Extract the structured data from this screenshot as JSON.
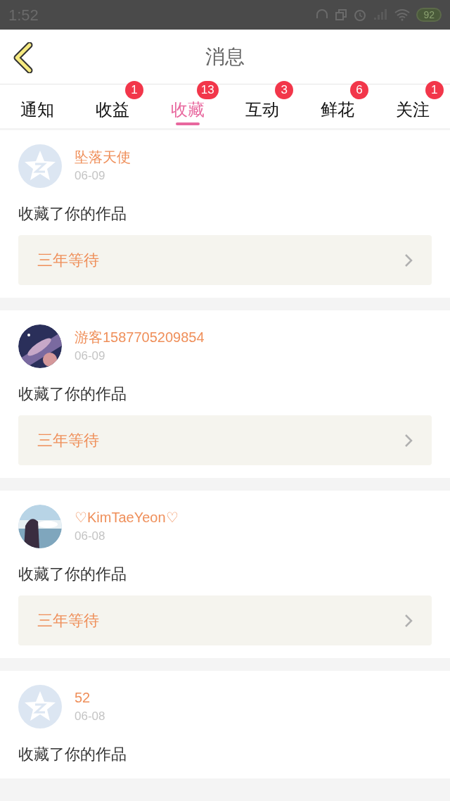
{
  "status_bar": {
    "time": "1:52",
    "battery": "92"
  },
  "header": {
    "title": "消息"
  },
  "tabs": [
    {
      "label": "通知",
      "selected": false
    },
    {
      "label": "收益",
      "selected": false,
      "badge": "1"
    },
    {
      "label": "收藏",
      "selected": true,
      "badge": "13"
    },
    {
      "label": "互动",
      "selected": false,
      "badge": "3"
    },
    {
      "label": "鲜花",
      "selected": false,
      "badge": "6"
    },
    {
      "label": "关注",
      "selected": false,
      "badge": "1"
    }
  ],
  "messages": [
    {
      "avatar": {
        "kind": "default"
      },
      "name": "坠落天使",
      "date": "06-09",
      "text": "收藏了你的作品",
      "work": "三年等待"
    },
    {
      "name": "游客1587705209854",
      "date": "06-09",
      "text": "收藏了你的作品",
      "work": "三年等待"
    },
    {
      "name": "♡KimTaeYeon♡",
      "date": "06-08",
      "text": "收藏了你的作品",
      "work": "三年等待"
    },
    {
      "avatar": {
        "kind": "default"
      },
      "name": "52",
      "date": "06-08",
      "text": "收藏了你的作品"
    }
  ]
}
